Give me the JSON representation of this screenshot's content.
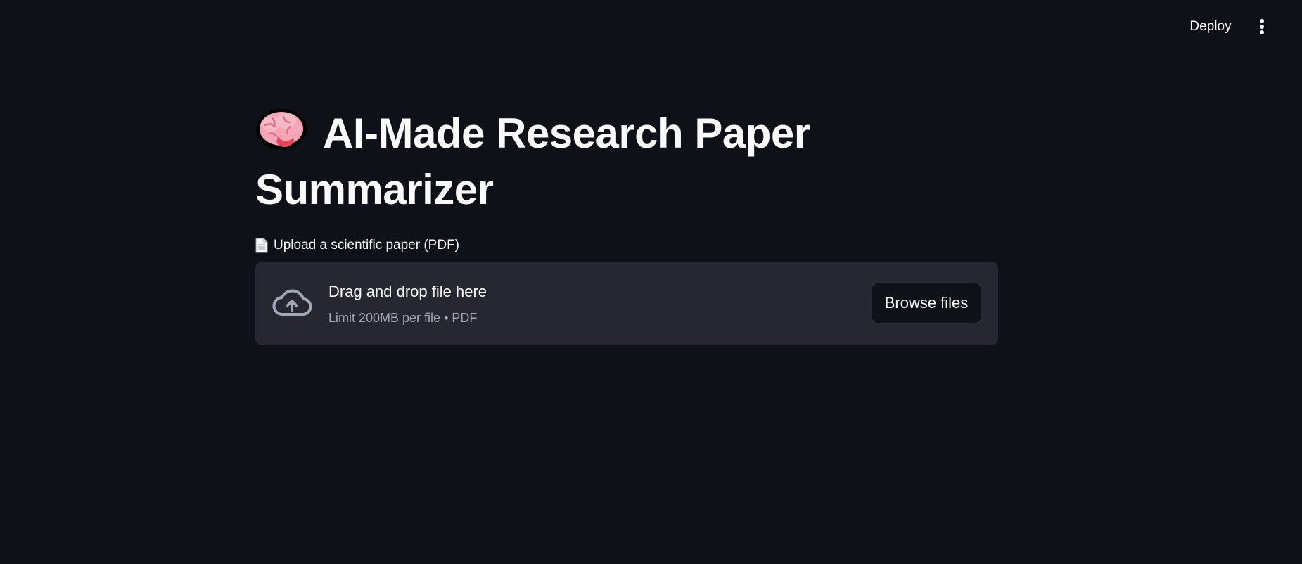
{
  "header": {
    "deploy_label": "Deploy",
    "menu_icon": "kebab-menu-icon"
  },
  "main": {
    "title_icon": "brain-emoji",
    "title": "AI-Made Research Paper Summarizer",
    "uploader": {
      "label_icon": "page-facing-up-emoji",
      "label": "Upload a scientific paper (PDF)",
      "dropzone_icon": "cloud-upload-icon",
      "drop_text": "Drag and drop file here",
      "limit_text": "Limit 200MB per file • PDF",
      "browse_label": "Browse files"
    }
  },
  "colors": {
    "background": "#0e1117",
    "dropzone_bg": "#262730",
    "text_primary": "#fafafa",
    "text_secondary": "#a3a8b8"
  }
}
